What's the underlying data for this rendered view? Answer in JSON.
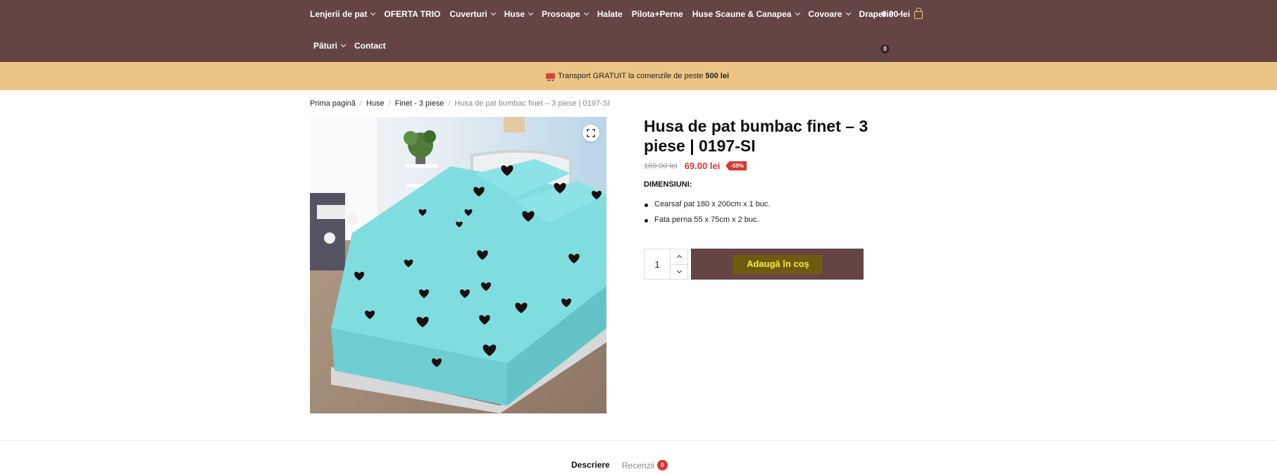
{
  "nav": {
    "row1": [
      {
        "label": "Lenjerii de pat",
        "has_dropdown": true
      },
      {
        "label": "OFERTA TRIO",
        "has_dropdown": false
      },
      {
        "label": "Cuverturi",
        "has_dropdown": true
      },
      {
        "label": "Huse",
        "has_dropdown": true
      },
      {
        "label": "Prosoape",
        "has_dropdown": true
      },
      {
        "label": "Halate",
        "has_dropdown": false
      },
      {
        "label": "Pilota+Perne",
        "has_dropdown": false
      },
      {
        "label": "Huse Scaune & Canapea",
        "has_dropdown": true
      },
      {
        "label": "Covoare",
        "has_dropdown": true
      },
      {
        "label": "Draperie",
        "has_dropdown": true
      }
    ],
    "row2": [
      {
        "label": "Pături",
        "has_dropdown": true
      },
      {
        "label": "Contact",
        "has_dropdown": false
      }
    ]
  },
  "cart": {
    "total": "0.00 lei",
    "count": "0",
    "icon": "shopping-bag-icon"
  },
  "promo": {
    "text_before": "Transport GRATUIT la comenzile de peste",
    "highlight": "500 lei",
    "icon": "truck-icon"
  },
  "breadcrumb": {
    "items": [
      "Prima pagină",
      "Huse",
      "Finet - 3 piese"
    ],
    "current": "Husa de pat bumbac finet – 3 piese | 0197-SI"
  },
  "product": {
    "title": "Husa de pat bumbac finet – 3 piese | 0197-SI",
    "old_price": "169.00 lei",
    "price": "69.00 lei",
    "discount_badge": "-59%",
    "dimensions_label": "DIMENSIUNI:",
    "dimensions": [
      "Cearsaf pat 180 x 200cm x 1 buc.",
      "Fata perna 55 x 75cm x 2 buc."
    ],
    "quantity": "1",
    "add_to_cart_label": "Adaugă în coș",
    "image_alt": "bed with light blue fitted sheet and black hearts",
    "colors": {
      "brand": "#654544",
      "promo": "#ecc586",
      "sale": "#d9362e",
      "fabric": "#7fdde0",
      "hearts": "#1b0e0e"
    }
  },
  "tabs": [
    {
      "label": "Descriere",
      "active": true
    },
    {
      "label": "Recenzii",
      "active": false,
      "count": "0"
    }
  ]
}
